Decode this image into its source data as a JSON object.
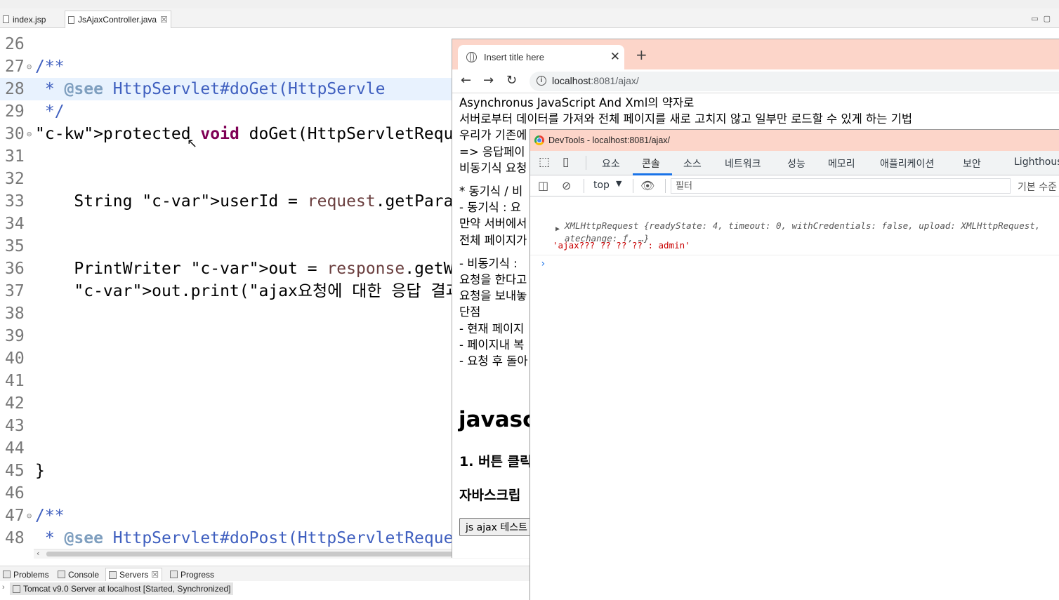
{
  "ide": {
    "tabs": [
      {
        "label": "index.jsp"
      },
      {
        "label": "JsAjaxController.java",
        "close": "☒"
      }
    ],
    "code_lines": [
      {
        "n": "26",
        "text": ""
      },
      {
        "n": "27",
        "text": "/**"
      },
      {
        "n": "28",
        "text": " * @see HttpServlet#doGet(HttpServle"
      },
      {
        "n": "29",
        "text": " */"
      },
      {
        "n": "30",
        "text": "protected void doGet(HttpServletRequ"
      },
      {
        "n": "31",
        "text": ""
      },
      {
        "n": "32",
        "text": ""
      },
      {
        "n": "33",
        "text": "    String userId = request.getParam"
      },
      {
        "n": "34",
        "text": ""
      },
      {
        "n": "35",
        "text": ""
      },
      {
        "n": "36",
        "text": "    PrintWriter out = response.getWr"
      },
      {
        "n": "37",
        "text": "    out.print(\"ajax요청에 대한 응답 결과"
      },
      {
        "n": "38",
        "text": ""
      },
      {
        "n": "39",
        "text": ""
      },
      {
        "n": "40",
        "text": ""
      },
      {
        "n": "41",
        "text": ""
      },
      {
        "n": "42",
        "text": ""
      },
      {
        "n": "43",
        "text": ""
      },
      {
        "n": "44",
        "text": ""
      },
      {
        "n": "45",
        "text": "}"
      },
      {
        "n": "46",
        "text": ""
      },
      {
        "n": "47",
        "text": "/**"
      },
      {
        "n": "48",
        "text": " * @see HttpServlet#doPost(HttpServletReque"
      }
    ],
    "bottom_tabs": [
      {
        "label": "Problems"
      },
      {
        "label": "Console"
      },
      {
        "label": "Servers",
        "close": "☒"
      },
      {
        "label": "Progress"
      }
    ],
    "server_row": "Tomcat v9.0 Server at localhost  [Started, Synchronized]"
  },
  "browser": {
    "tab_title": "Insert title here",
    "tab_close": "✕",
    "new_tab": "+",
    "url_host": "localhost",
    "url_rest": ":8081/ajax/",
    "page_lines": [
      "Asynchronus JavaScript And Xml의 약자로",
      "서버로부터 데이터를 가져와 전체 페이지를 새로 고치지 않고 일부만 로드할 수 있게 하는 기법",
      "우리가 기존에",
      "=> 응답페이",
      "비동기식 요청",
      "",
      "* 동기식 / 비",
      "- 동기식 : 요",
      "만약 서버에서",
      "전체 페이지가",
      "",
      "- 비동기식 :",
      "요청을 한다고",
      "요청을 보내놓",
      "단점",
      "- 현재 페이지",
      "- 페이지내 복",
      "- 요청 후 돌아"
    ],
    "heading": "javasc",
    "h4_1": "1. 버튼 클릭",
    "h4_2": "자바스크립",
    "button": "js ajax 테스트"
  },
  "devtools": {
    "title": "DevTools - localhost:8081/ajax/",
    "tabs": [
      "요소",
      "콘솔",
      "소스",
      "네트워크",
      "성능",
      "메모리",
      "애플리케이션",
      "보안",
      "Lighthouse"
    ],
    "active_tab": "콘솔",
    "context": "top",
    "filter_placeholder": "필터",
    "levels": "기본 수준",
    "log_obj_line1": "XMLHttpRequest {readyState: 4, timeout: 0, withCredentials: false, upload: XMLHttpRequest,",
    "log_obj_line2": "atechange: f, …}",
    "log_text": "'ajax??? ?? ?? ?? : admin'",
    "prompt": "›"
  },
  "colors": {
    "keyword": "#7f0055",
    "comment": "#3f5fbf",
    "string": "#2a00ff",
    "variable": "#6a3e3e",
    "titlebar": "#fcd5c9",
    "devtools_accent": "#1a73e8"
  }
}
